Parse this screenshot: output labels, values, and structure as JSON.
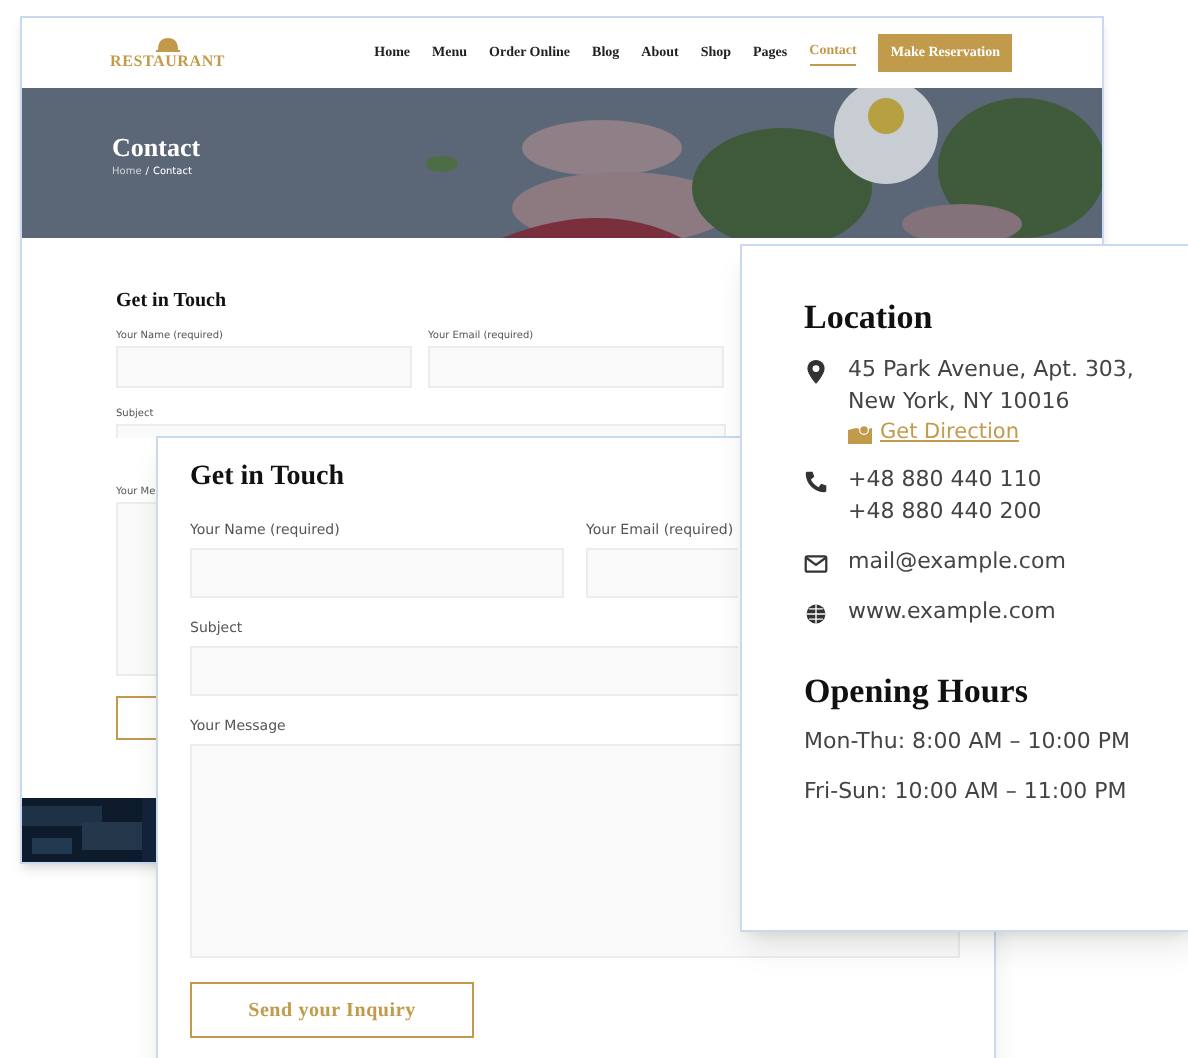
{
  "back_page": {
    "logo": "RESTAURANT",
    "nav": [
      {
        "label": "Home",
        "selected": false
      },
      {
        "label": "Menu",
        "selected": false
      },
      {
        "label": "Order Online",
        "selected": false
      },
      {
        "label": "Blog",
        "selected": false
      },
      {
        "label": "About",
        "selected": false
      },
      {
        "label": "Shop",
        "selected": false
      },
      {
        "label": "Pages",
        "selected": false
      },
      {
        "label": "Contact",
        "selected": true
      }
    ],
    "cta": "Make Reservation",
    "hero": {
      "title": "Contact",
      "breadcrumb": [
        "Home",
        "Contact"
      ],
      "separator": "/"
    },
    "form": {
      "title": "Get in Touch",
      "fields": [
        {
          "kind": "half",
          "label": "Your Name (required)"
        },
        {
          "kind": "half",
          "label": "Your Email (required)"
        },
        {
          "kind": "full",
          "label": "Subject"
        },
        {
          "kind": "textarea",
          "label": "Your Me"
        }
      ]
    }
  },
  "front_form": {
    "title": "Get in Touch",
    "fields": [
      {
        "kind": "half",
        "label": "Your Name (required)"
      },
      {
        "kind": "half",
        "label": "Your Email (required)"
      },
      {
        "kind": "full",
        "label": "Subject"
      },
      {
        "kind": "textarea",
        "label": "Your Message"
      }
    ],
    "button": "Send your Inquiry"
  },
  "location_card": {
    "title": "Location",
    "items": [
      {
        "kind": "address",
        "lines": [
          "45 Park Avenue, Apt. 303,",
          "New York, NY 10016"
        ],
        "link": "Get Direction"
      },
      {
        "kind": "phone",
        "lines": [
          "+48 880 440 110",
          "+48 880 440 200"
        ]
      },
      {
        "kind": "email",
        "lines": [
          "mail@example.com"
        ]
      },
      {
        "kind": "web",
        "lines": [
          "www.example.com"
        ]
      }
    ],
    "hours_title": "Opening Hours",
    "hours": [
      "Mon-Thu: 8:00 AM – 10:00 PM",
      "Fri-Sun: 10:00 AM – 11:00 PM"
    ]
  }
}
